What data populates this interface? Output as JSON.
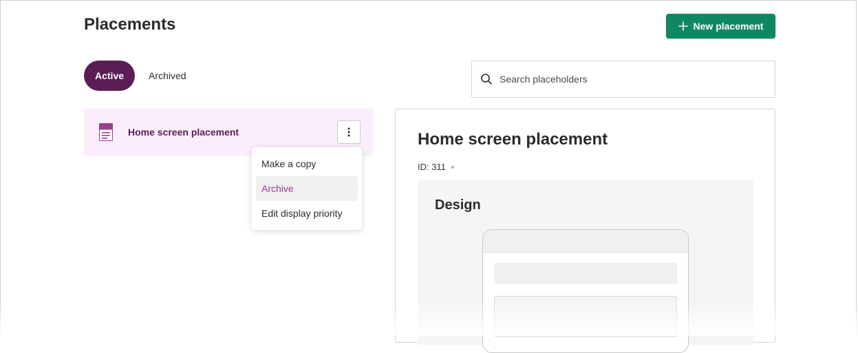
{
  "page": {
    "title": "Placements"
  },
  "header": {
    "new_button_label": "New placement"
  },
  "tabs": [
    {
      "label": "Active",
      "selected": true
    },
    {
      "label": "Archived",
      "selected": false
    }
  ],
  "search": {
    "placeholder": "Search placeholders",
    "value": ""
  },
  "placements": [
    {
      "name": "Home screen placement",
      "icon": "document-icon",
      "selected": true
    }
  ],
  "context_menu": {
    "items": [
      {
        "label": "Make a copy",
        "hovered": false
      },
      {
        "label": "Archive",
        "hovered": true
      },
      {
        "label": "Edit display priority",
        "hovered": false
      }
    ]
  },
  "detail": {
    "title": "Home screen placement",
    "id_text": "ID: 311",
    "design_title": "Design"
  },
  "colors": {
    "brand_purple": "#5c1d55",
    "primary_green": "#0f8763",
    "selected_row_bg": "#fbeefb",
    "menu_hover_text": "#9a3d93"
  }
}
